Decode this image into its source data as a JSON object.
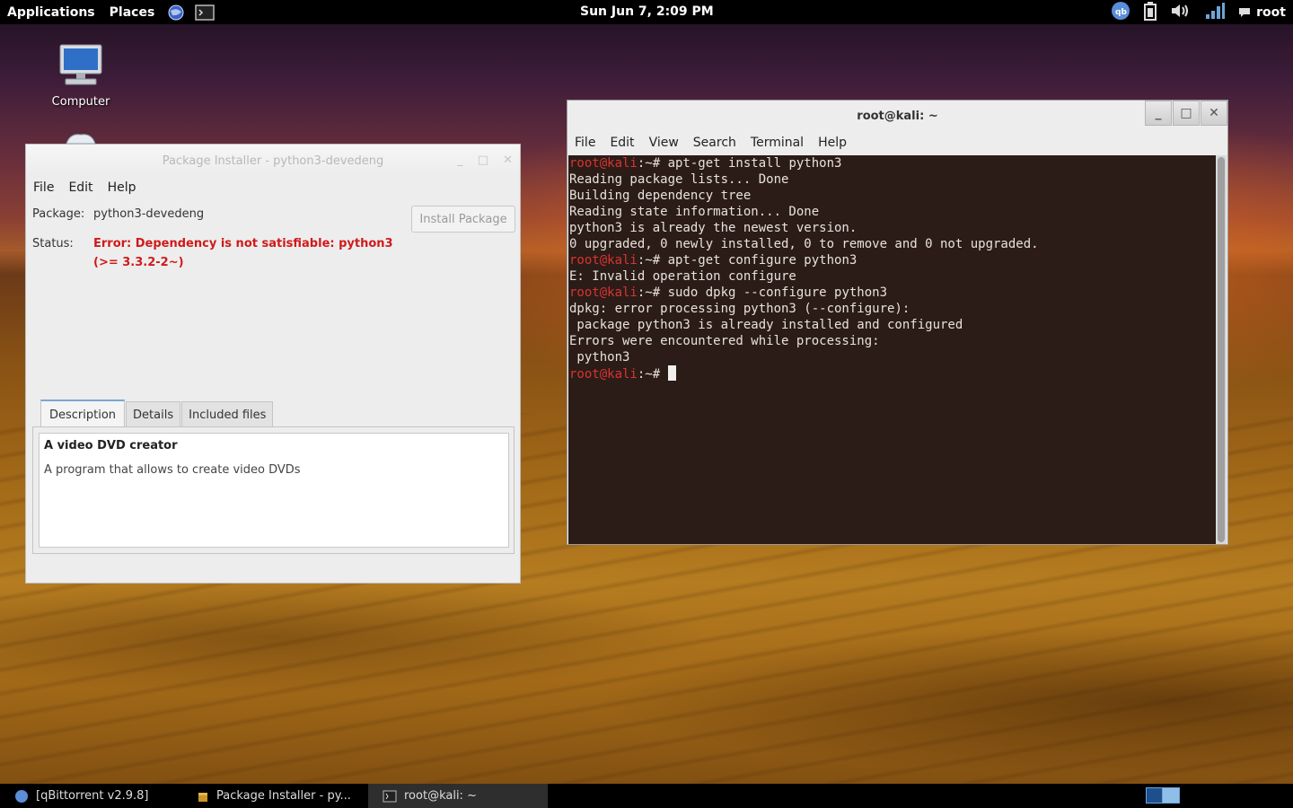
{
  "top_panel": {
    "applications": "Applications",
    "places": "Places",
    "clock": "Sun Jun  7,  2:09 PM",
    "user": "root"
  },
  "desktop": {
    "icons": [
      {
        "label": "Computer"
      }
    ]
  },
  "package_installer": {
    "title": "Package Installer - python3-devedeng",
    "menu": [
      "File",
      "Edit",
      "Help"
    ],
    "package_label": "Package:",
    "package_value": "python3-devedeng",
    "status_label": "Status:",
    "status_line1": "Error: Dependency is not satisfiable: python3",
    "status_line2": "(>= 3.3.2-2~)",
    "install_button": "Install Package",
    "tabs": [
      "Description",
      "Details",
      "Included files"
    ],
    "description_title": "A video DVD creator",
    "description_body": "A program that allows to create video DVDs"
  },
  "terminal": {
    "title": "root@kali: ~",
    "menu": [
      "File",
      "Edit",
      "View",
      "Search",
      "Terminal",
      "Help"
    ],
    "prompt_user": "root@kali",
    "prompt_suffix": ":~# ",
    "lines": [
      {
        "prompt": true,
        "text": "apt-get install python3"
      },
      {
        "prompt": false,
        "text": "Reading package lists... Done"
      },
      {
        "prompt": false,
        "text": "Building dependency tree"
      },
      {
        "prompt": false,
        "text": "Reading state information... Done"
      },
      {
        "prompt": false,
        "text": "python3 is already the newest version."
      },
      {
        "prompt": false,
        "text": "0 upgraded, 0 newly installed, 0 to remove and 0 not upgraded."
      },
      {
        "prompt": true,
        "text": "apt-get configure python3"
      },
      {
        "prompt": false,
        "text": "E: Invalid operation configure"
      },
      {
        "prompt": true,
        "text": "sudo dpkg --configure python3"
      },
      {
        "prompt": false,
        "text": "dpkg: error processing python3 (--configure):"
      },
      {
        "prompt": false,
        "text": " package python3 is already installed and configured"
      },
      {
        "prompt": false,
        "text": "Errors were encountered while processing:"
      },
      {
        "prompt": false,
        "text": " python3"
      },
      {
        "prompt": true,
        "text": "",
        "cursor": true
      }
    ]
  },
  "taskbar": {
    "items": [
      {
        "label": "[qBittorrent v2.9.8]",
        "icon": "qbittorrent-icon",
        "active": false
      },
      {
        "label": "Package Installer - py...",
        "icon": "package-icon",
        "active": false
      },
      {
        "label": "root@kali: ~",
        "icon": "terminal-icon",
        "active": true
      }
    ]
  },
  "colors": {
    "error_red": "#d01a1a",
    "prompt_red": "#d93434",
    "terminal_bg": "#2b1c17",
    "tab_accent": "#7aa6d6"
  }
}
